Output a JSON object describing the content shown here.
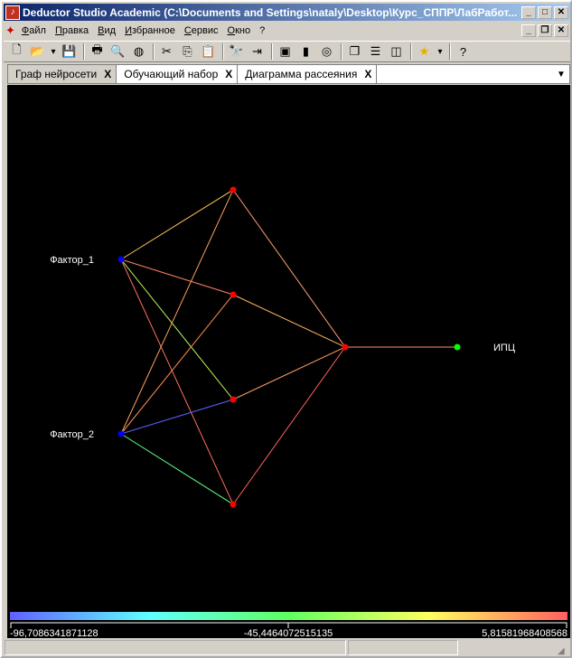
{
  "window": {
    "title": "Deductor Studio Academic (C:\\Documents and Settings\\nataly\\Desktop\\Курс_СППР\\ЛабРабот..."
  },
  "menu": [
    "Файл",
    "Правка",
    "Вид",
    "Избранное",
    "Сервис",
    "Окно",
    "?"
  ],
  "toolbar": [
    {
      "icon": "new-icon",
      "glyph": "🗋"
    },
    {
      "icon": "open-icon",
      "glyph": "📂"
    },
    {
      "icon": "dropdown-icon",
      "glyph": "▾"
    },
    {
      "icon": "save-icon",
      "glyph": "💾"
    },
    {
      "sep": true
    },
    {
      "icon": "print-icon",
      "glyph": "🖶"
    },
    {
      "icon": "preview-icon",
      "glyph": "🔍"
    },
    {
      "icon": "export-icon",
      "glyph": "◍"
    },
    {
      "sep": true
    },
    {
      "icon": "cut-icon",
      "glyph": "✂"
    },
    {
      "icon": "copy-icon",
      "glyph": "⎘"
    },
    {
      "icon": "paste-icon",
      "glyph": "📋"
    },
    {
      "sep": true
    },
    {
      "icon": "find-icon",
      "glyph": "🔭"
    },
    {
      "icon": "find-next-icon",
      "glyph": "⇥"
    },
    {
      "sep": true
    },
    {
      "icon": "wizard-icon",
      "glyph": "▣"
    },
    {
      "icon": "book-icon",
      "glyph": "▮"
    },
    {
      "icon": "help-circle-icon",
      "glyph": "◎"
    },
    {
      "sep": true
    },
    {
      "icon": "cascade-icon",
      "glyph": "❐"
    },
    {
      "icon": "tile-horizontal-icon",
      "glyph": "☰"
    },
    {
      "icon": "tile-vertical-icon",
      "glyph": "◫"
    },
    {
      "sep": true
    },
    {
      "icon": "favorites-star-icon",
      "glyph": "★"
    },
    {
      "icon": "dropdown-icon",
      "glyph": "▾"
    },
    {
      "sep": true
    },
    {
      "icon": "help-icon",
      "glyph": "?"
    }
  ],
  "tabs": [
    {
      "label": "Граф нейросети",
      "active": true
    },
    {
      "label": "Обучающий набор"
    },
    {
      "label": "Диаграмма рассеяния"
    }
  ],
  "graph": {
    "nodes": [
      {
        "id": "f1",
        "label": "Фактор_1",
        "color": "#0000ff"
      },
      {
        "id": "f2",
        "label": "Фактор_2",
        "color": "#0000ff"
      },
      {
        "id": "h1",
        "label": "",
        "color": "#ff0000"
      },
      {
        "id": "h2",
        "label": "",
        "color": "#ff0000"
      },
      {
        "id": "h3",
        "label": "",
        "color": "#ff0000"
      },
      {
        "id": "h4",
        "label": "",
        "color": "#ff0000"
      },
      {
        "id": "o1",
        "label": "",
        "color": "#ff0000"
      },
      {
        "id": "out",
        "label": "ИПЦ",
        "color": "#00ff00"
      }
    ],
    "edges": [
      {
        "from": "f1",
        "to": "h1",
        "color": "#ffc060"
      },
      {
        "from": "f1",
        "to": "h2",
        "color": "#ff8060"
      },
      {
        "from": "f1",
        "to": "h3",
        "color": "#c0ff60"
      },
      {
        "from": "f1",
        "to": "h4",
        "color": "#ff7060"
      },
      {
        "from": "f2",
        "to": "h1",
        "color": "#ffa060"
      },
      {
        "from": "f2",
        "to": "h2",
        "color": "#ff9050"
      },
      {
        "from": "f2",
        "to": "h3",
        "color": "#6060ff"
      },
      {
        "from": "f2",
        "to": "h4",
        "color": "#60ff80"
      },
      {
        "from": "h1",
        "to": "o1",
        "color": "#ffa070"
      },
      {
        "from": "h2",
        "to": "o1",
        "color": "#ffb060"
      },
      {
        "from": "h3",
        "to": "o1",
        "color": "#ffa060"
      },
      {
        "from": "h4",
        "to": "o1",
        "color": "#ff6060"
      },
      {
        "from": "o1",
        "to": "out",
        "color": "#ff9070"
      }
    ]
  },
  "scale": {
    "min": "-96,7086341871128",
    "mid": "-45,4464072515135",
    "max": "5,81581968408568",
    "colors": [
      "#6060ff",
      "#60ffff",
      "#60ff60",
      "#ffff60",
      "#ff6060"
    ]
  }
}
